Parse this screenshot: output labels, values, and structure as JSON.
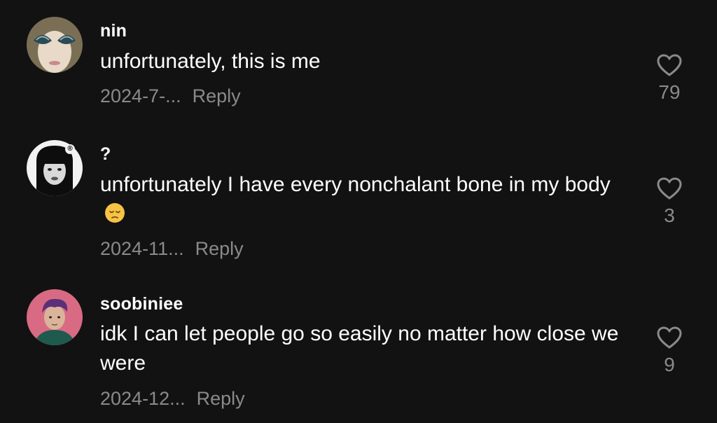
{
  "comments": [
    {
      "username": "nin",
      "text": "unfortunately, this is me",
      "emoji": "",
      "date": "2024-7-...",
      "reply_label": "Reply",
      "likes": "79",
      "avatar_icon": "alien-sunglasses-avatar"
    },
    {
      "username": "?",
      "text": "unfortunately I have every nonchalant bone in my body",
      "emoji": "pensive-face",
      "date": "2024-11...",
      "reply_label": "Reply",
      "likes": "3",
      "avatar_icon": "bangs-portrait-avatar"
    },
    {
      "username": "soobiniee",
      "text": "idk I can let people go so easily no matter how close we were",
      "emoji": "",
      "date": "2024-12...",
      "reply_label": "Reply",
      "likes": "9",
      "avatar_icon": "purple-hair-avatar"
    }
  ],
  "colors": {
    "background": "#121212",
    "text": "#ffffff",
    "muted": "#8a8a8a"
  }
}
